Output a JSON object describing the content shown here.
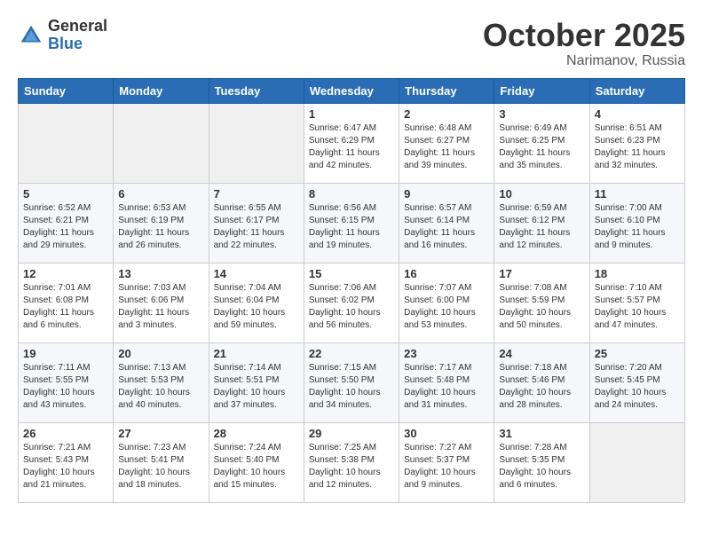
{
  "logo": {
    "general": "General",
    "blue": "Blue"
  },
  "title": {
    "month_year": "October 2025",
    "location": "Narimanov, Russia"
  },
  "headers": [
    "Sunday",
    "Monday",
    "Tuesday",
    "Wednesday",
    "Thursday",
    "Friday",
    "Saturday"
  ],
  "weeks": [
    [
      {
        "day": "",
        "info": ""
      },
      {
        "day": "",
        "info": ""
      },
      {
        "day": "",
        "info": ""
      },
      {
        "day": "1",
        "info": "Sunrise: 6:47 AM\nSunset: 6:29 PM\nDaylight: 11 hours\nand 42 minutes."
      },
      {
        "day": "2",
        "info": "Sunrise: 6:48 AM\nSunset: 6:27 PM\nDaylight: 11 hours\nand 39 minutes."
      },
      {
        "day": "3",
        "info": "Sunrise: 6:49 AM\nSunset: 6:25 PM\nDaylight: 11 hours\nand 35 minutes."
      },
      {
        "day": "4",
        "info": "Sunrise: 6:51 AM\nSunset: 6:23 PM\nDaylight: 11 hours\nand 32 minutes."
      }
    ],
    [
      {
        "day": "5",
        "info": "Sunrise: 6:52 AM\nSunset: 6:21 PM\nDaylight: 11 hours\nand 29 minutes."
      },
      {
        "day": "6",
        "info": "Sunrise: 6:53 AM\nSunset: 6:19 PM\nDaylight: 11 hours\nand 26 minutes."
      },
      {
        "day": "7",
        "info": "Sunrise: 6:55 AM\nSunset: 6:17 PM\nDaylight: 11 hours\nand 22 minutes."
      },
      {
        "day": "8",
        "info": "Sunrise: 6:56 AM\nSunset: 6:15 PM\nDaylight: 11 hours\nand 19 minutes."
      },
      {
        "day": "9",
        "info": "Sunrise: 6:57 AM\nSunset: 6:14 PM\nDaylight: 11 hours\nand 16 minutes."
      },
      {
        "day": "10",
        "info": "Sunrise: 6:59 AM\nSunset: 6:12 PM\nDaylight: 11 hours\nand 12 minutes."
      },
      {
        "day": "11",
        "info": "Sunrise: 7:00 AM\nSunset: 6:10 PM\nDaylight: 11 hours\nand 9 minutes."
      }
    ],
    [
      {
        "day": "12",
        "info": "Sunrise: 7:01 AM\nSunset: 6:08 PM\nDaylight: 11 hours\nand 6 minutes."
      },
      {
        "day": "13",
        "info": "Sunrise: 7:03 AM\nSunset: 6:06 PM\nDaylight: 11 hours\nand 3 minutes."
      },
      {
        "day": "14",
        "info": "Sunrise: 7:04 AM\nSunset: 6:04 PM\nDaylight: 10 hours\nand 59 minutes."
      },
      {
        "day": "15",
        "info": "Sunrise: 7:06 AM\nSunset: 6:02 PM\nDaylight: 10 hours\nand 56 minutes."
      },
      {
        "day": "16",
        "info": "Sunrise: 7:07 AM\nSunset: 6:00 PM\nDaylight: 10 hours\nand 53 minutes."
      },
      {
        "day": "17",
        "info": "Sunrise: 7:08 AM\nSunset: 5:59 PM\nDaylight: 10 hours\nand 50 minutes."
      },
      {
        "day": "18",
        "info": "Sunrise: 7:10 AM\nSunset: 5:57 PM\nDaylight: 10 hours\nand 47 minutes."
      }
    ],
    [
      {
        "day": "19",
        "info": "Sunrise: 7:11 AM\nSunset: 5:55 PM\nDaylight: 10 hours\nand 43 minutes."
      },
      {
        "day": "20",
        "info": "Sunrise: 7:13 AM\nSunset: 5:53 PM\nDaylight: 10 hours\nand 40 minutes."
      },
      {
        "day": "21",
        "info": "Sunrise: 7:14 AM\nSunset: 5:51 PM\nDaylight: 10 hours\nand 37 minutes."
      },
      {
        "day": "22",
        "info": "Sunrise: 7:15 AM\nSunset: 5:50 PM\nDaylight: 10 hours\nand 34 minutes."
      },
      {
        "day": "23",
        "info": "Sunrise: 7:17 AM\nSunset: 5:48 PM\nDaylight: 10 hours\nand 31 minutes."
      },
      {
        "day": "24",
        "info": "Sunrise: 7:18 AM\nSunset: 5:46 PM\nDaylight: 10 hours\nand 28 minutes."
      },
      {
        "day": "25",
        "info": "Sunrise: 7:20 AM\nSunset: 5:45 PM\nDaylight: 10 hours\nand 24 minutes."
      }
    ],
    [
      {
        "day": "26",
        "info": "Sunrise: 7:21 AM\nSunset: 5:43 PM\nDaylight: 10 hours\nand 21 minutes."
      },
      {
        "day": "27",
        "info": "Sunrise: 7:23 AM\nSunset: 5:41 PM\nDaylight: 10 hours\nand 18 minutes."
      },
      {
        "day": "28",
        "info": "Sunrise: 7:24 AM\nSunset: 5:40 PM\nDaylight: 10 hours\nand 15 minutes."
      },
      {
        "day": "29",
        "info": "Sunrise: 7:25 AM\nSunset: 5:38 PM\nDaylight: 10 hours\nand 12 minutes."
      },
      {
        "day": "30",
        "info": "Sunrise: 7:27 AM\nSunset: 5:37 PM\nDaylight: 10 hours\nand 9 minutes."
      },
      {
        "day": "31",
        "info": "Sunrise: 7:28 AM\nSunset: 5:35 PM\nDaylight: 10 hours\nand 6 minutes."
      },
      {
        "day": "",
        "info": ""
      }
    ]
  ]
}
